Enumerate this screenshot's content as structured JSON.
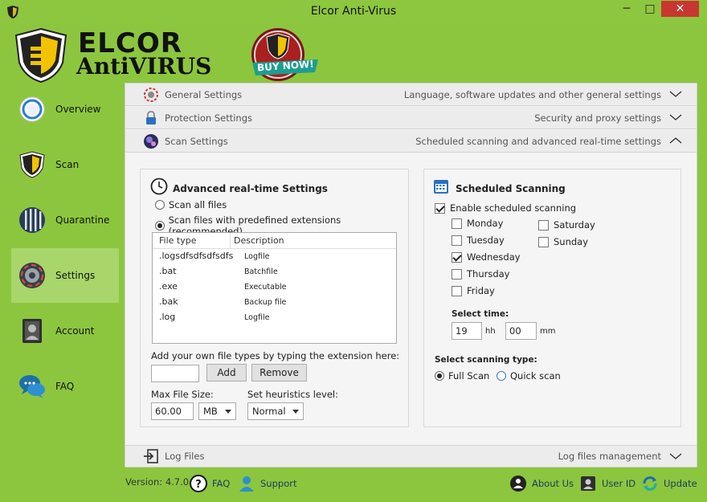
{
  "window": {
    "title": "Elcor Anti-Virus",
    "minimize": "─",
    "maximize": "□",
    "close": "✕"
  },
  "brand": {
    "line1": "ELCOR",
    "line2": "AntiVIRUS",
    "buy_now": "BUY NOW!"
  },
  "nav": [
    {
      "label": "Overview",
      "icon": "overview-icon"
    },
    {
      "label": "Scan",
      "icon": "shield-icon"
    },
    {
      "label": "Quarantine",
      "icon": "quarantine-icon"
    },
    {
      "label": "Settings",
      "icon": "gear-icon"
    },
    {
      "label": "Account",
      "icon": "account-icon"
    },
    {
      "label": "FAQ",
      "icon": "chat-icon"
    }
  ],
  "sections": {
    "general": {
      "title": "General Settings",
      "desc": "Language, software updates and other general settings"
    },
    "protection": {
      "title": "Protection Settings",
      "desc": "Security and proxy settings"
    },
    "scan": {
      "title": "Scan Settings",
      "desc": "Scheduled scanning and advanced real-time settings"
    },
    "log": {
      "title": "Log Files",
      "desc": "Log files management"
    }
  },
  "realtime": {
    "title": "Advanced real-time Settings",
    "opt_all": "Scan all files",
    "opt_ext": "Scan files with predefined extensions (recommended)",
    "col_type": "File type",
    "col_desc": "Description",
    "rows": [
      {
        "type": ".logsdfsdfsdfsdfs",
        "desc": "Logfile"
      },
      {
        "type": ".bat",
        "desc": "Batchfile"
      },
      {
        "type": ".exe",
        "desc": "Executable"
      },
      {
        "type": ".bak",
        "desc": "Backup file"
      },
      {
        "type": ".log",
        "desc": "Logfile"
      }
    ],
    "add_hint": "Add your own file types by typing the extension here:",
    "add_value": "",
    "add_btn": "Add",
    "remove_btn": "Remove",
    "max_size_label": "Max File Size:",
    "max_size_value": "60.00",
    "size_unit": "MB",
    "heuristics_label": "Set heuristics level:",
    "heuristics_value": "Normal"
  },
  "scheduled": {
    "title": "Scheduled Scanning",
    "enable": "Enable scheduled scanning",
    "days": {
      "monday": "Monday",
      "tuesday": "Tuesday",
      "wednesday": "Wednesday",
      "thursday": "Thursday",
      "friday": "Friday",
      "saturday": "Saturday",
      "sunday": "Sunday"
    },
    "select_time": "Select time:",
    "hour": "19",
    "hh": "hh",
    "minute": "00",
    "mm": "mm",
    "scan_type_label": "Select scanning type:",
    "full_scan": "Full Scan",
    "quick_scan": "Quick scan"
  },
  "footer": {
    "version": "Version: 4.7.0",
    "faq": "FAQ",
    "support": "Support",
    "about": "About Us",
    "user_id": "User ID",
    "update": "Update"
  }
}
